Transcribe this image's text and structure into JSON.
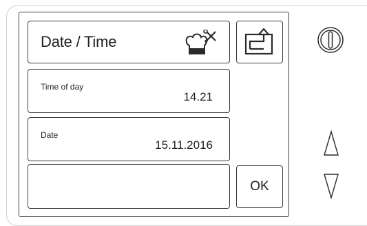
{
  "header": {
    "title": "Date / Time",
    "icon": "chef-hat-tools-icon"
  },
  "buttons": {
    "exit_icon": "exit-arrow-icon",
    "ok_label": "OK"
  },
  "fields": [
    {
      "label": "Time of day",
      "value": "14.21"
    },
    {
      "label": "Date",
      "value": "15.11.2016"
    }
  ],
  "side_controls": {
    "power_icon": "power-icon",
    "up_icon": "triangle-up-icon",
    "down_icon": "triangle-down-icon"
  },
  "colors": {
    "outline": "#3a3a3a",
    "bezel": "#d2d2d2",
    "background": "#ffffff"
  }
}
